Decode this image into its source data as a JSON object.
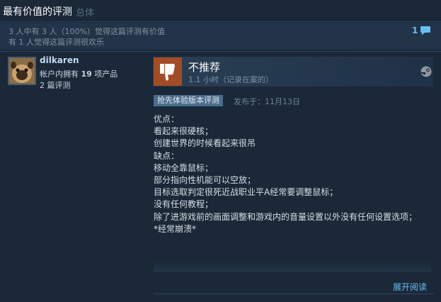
{
  "header": {
    "title": "最有价值的评测",
    "subtitle": "总体"
  },
  "summary": {
    "helpful_text": "3 人中有 3 人（100%）觉得这篇评测有价值",
    "funny_text": "有 1 人觉得这篇评测很欢乐",
    "comment_count": "1"
  },
  "reviewer": {
    "name": "dilkaren",
    "products_prefix": "帐户内拥有 ",
    "products_count": "19",
    "products_suffix": " 项产品",
    "reviews_text": "2 篇评测"
  },
  "review": {
    "verdict": "不推荐",
    "hours": "1.1 小时（记录在案的）",
    "early_access_label": "抢先体验版本评测",
    "posted": "发布于：11月13日",
    "lines": [
      "优点：",
      "看起来很硬核；",
      "创建世界的时候看起来很吊",
      "",
      "缺点：",
      "移动全靠鼠标；",
      "部分指向性机能可以空放；",
      "目标选取判定很死近战职业平A经常要调整鼠标；",
      "没有任何教程；",
      "除了进游戏前的画面调整和游戏内的音量设置以外没有任何设置选项；",
      "*经常崩溃*"
    ],
    "read_more": "展开阅读"
  },
  "colors": {
    "background": "#1b2838",
    "thumb_down_bg": "#a34c25",
    "link": "#66c0f4"
  },
  "icons": [
    "comment-icon",
    "thumbs-down-icon",
    "steam-icon",
    "avatar"
  ]
}
